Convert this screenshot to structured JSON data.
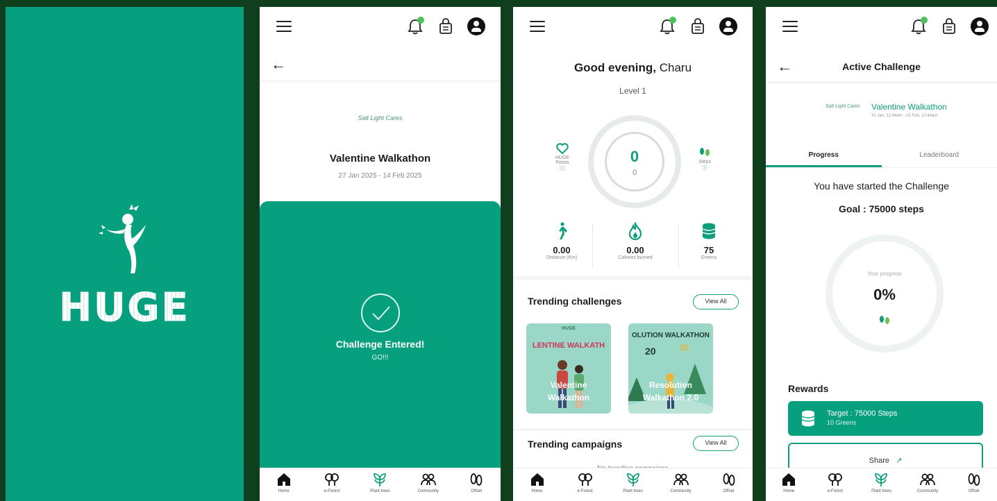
{
  "splash": {
    "brand": "HUGE",
    "bg_color": "#07a07e"
  },
  "nav": {
    "items": [
      {
        "label": "Home",
        "icon": "home-icon"
      },
      {
        "label": "e-Forest",
        "icon": "tree-icon"
      },
      {
        "label": "Plant trees",
        "icon": "plant-icon"
      },
      {
        "label": "Community",
        "icon": "community-icon"
      },
      {
        "label": "Offset",
        "icon": "footprint-icon"
      }
    ]
  },
  "entered": {
    "brand": "Salt Light Cares",
    "title": "Valentine Walkathon",
    "dates": "27 Jan 2025 - 14 Feb 2025",
    "status": "Challenge Entered!",
    "sub": "GO!!!"
  },
  "home": {
    "greeting_prefix": "Good evening,",
    "user": "Charu",
    "level": "Level 1",
    "ring_value": "0",
    "ring_sub": "0",
    "points_label_1": "HUGE",
    "points_label_2": "Points",
    "steps_label": "Steps",
    "stats": [
      {
        "value": "0.00",
        "label": "Distance (Km)"
      },
      {
        "value": "0.00",
        "label": "Calories burned"
      },
      {
        "value": "75",
        "label": "Greens"
      }
    ],
    "trending_challenges": "Trending challenges",
    "view_all": "View All",
    "cards": [
      {
        "header": "LENTINE WALKATH",
        "badge": "HUGE",
        "name_1": "Valentine",
        "name_2": "Walkathon"
      },
      {
        "header": "OLUTION WALKATHON",
        "badge": "20",
        "badge_2": "25",
        "name_1": "Resolution",
        "name_2": "Walkathon 2.0"
      }
    ],
    "trending_campaigns": "Trending campaigns",
    "campaigns_empty": "No trending campaigns"
  },
  "active": {
    "title": "Active Challenge",
    "brand": "Salt Light Cares",
    "challenge": "Valentine Walkathon",
    "dates": "31 Jan, 12:44am - 15 Feb, 12:44am",
    "tabs": [
      "Progress",
      "Leaderboard"
    ],
    "started": "You have started the Challenge",
    "goal": "Goal : 75000 steps",
    "progress_label": "Your progress",
    "progress_value": "0%",
    "rewards": "Rewards",
    "reward_target": "Target : 75000 Steps",
    "reward_value": "10 Greens",
    "share": "Share"
  }
}
